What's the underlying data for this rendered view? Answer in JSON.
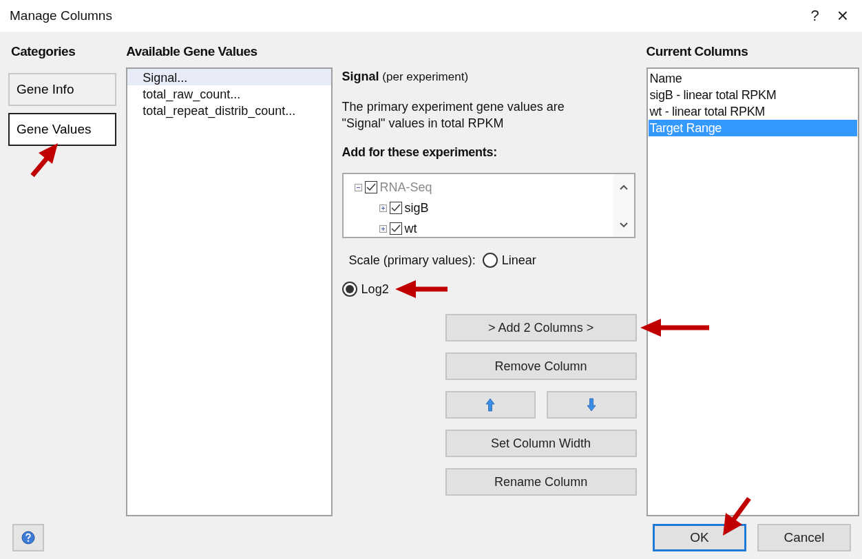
{
  "window": {
    "title": "Manage Columns",
    "help": "?",
    "close": "×"
  },
  "categories": {
    "heading": "Categories",
    "items": [
      {
        "label": "Gene Info",
        "selected": false
      },
      {
        "label": "Gene Values",
        "selected": true
      }
    ]
  },
  "available": {
    "heading": "Available Gene Values",
    "items": [
      {
        "label": "Signal...",
        "selected": true
      },
      {
        "label": "total_raw_count...",
        "selected": false
      },
      {
        "label": "total_repeat_distrib_count...",
        "selected": false
      }
    ]
  },
  "detail": {
    "title": "**Signal** (per experiment)",
    "description": "The primary experiment gene values are \"Signal\" values in total RPKM",
    "experiments_heading": "Add for these experiments:",
    "tree": [
      {
        "label": "RNA-Seq",
        "checked": true,
        "expanded": true,
        "disabled": true,
        "children": [
          {
            "label": "sigB",
            "checked": true,
            "expanded": false,
            "disabled": false
          },
          {
            "label": "wt",
            "checked": true,
            "expanded": false,
            "disabled": false
          }
        ]
      }
    ],
    "scale_label": "Scale (primary values):",
    "scale_options": [
      {
        "label": "Linear",
        "selected": false
      },
      {
        "label": "Log2",
        "selected": true
      }
    ]
  },
  "actions": [
    {
      "kind": "text",
      "label": "> Add 2 Columns >"
    },
    {
      "kind": "text",
      "label": "Remove Column"
    },
    {
      "kind": "up"
    },
    {
      "kind": "down"
    },
    {
      "kind": "text",
      "label": "Set Column Width"
    },
    {
      "kind": "text",
      "label": "Rename Column"
    }
  ],
  "current": {
    "heading": "Current Columns",
    "items": [
      {
        "label": "Name",
        "selected": false
      },
      {
        "label": "sigB - linear total RPKM",
        "selected": false
      },
      {
        "label": "wt - linear total RPKM",
        "selected": false
      },
      {
        "label": "Target Range",
        "selected": true
      }
    ]
  },
  "footer": {
    "buttons": [
      {
        "label": "OK",
        "default": true
      },
      {
        "label": "Cancel",
        "default": false
      }
    ]
  }
}
